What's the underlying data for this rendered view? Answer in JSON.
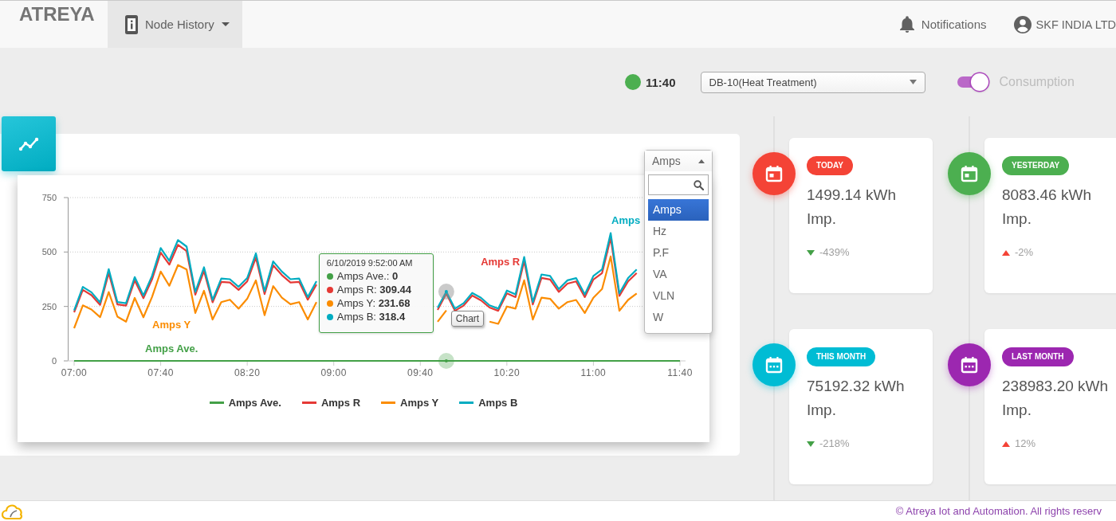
{
  "navbar": {
    "brand": "ATREYA",
    "menu": {
      "label": "Node History",
      "selected": true
    },
    "notifications": "Notifications",
    "account": "SKF INDIA LTD"
  },
  "toolbar": {
    "status": {
      "online": true,
      "time": "11:40"
    },
    "node_select": {
      "value": "DB-10(Heat Treatment)"
    },
    "toggle": {
      "on": true,
      "label": "Consumption"
    }
  },
  "chart_panel": {
    "unit_select": {
      "value": "Amps",
      "expanded": true,
      "options": [
        {
          "label": "Amps",
          "selected": true
        },
        {
          "label": "Hz",
          "selected": false
        },
        {
          "label": "P.F",
          "selected": false
        },
        {
          "label": "VA",
          "selected": false
        },
        {
          "label": "VLN",
          "selected": false
        },
        {
          "label": "W",
          "selected": false
        }
      ]
    },
    "chart_data": {
      "type": "line",
      "categories": [
        "07:00",
        null,
        null,
        null,
        null,
        null,
        null,
        null,
        null,
        null,
        "07:40",
        null,
        null,
        null,
        null,
        null,
        null,
        null,
        null,
        null,
        "08:20",
        null,
        null,
        null,
        null,
        null,
        null,
        null,
        null,
        null,
        "09:00",
        null,
        null,
        null,
        null,
        null,
        null,
        null,
        null,
        null,
        "09:40",
        null,
        null,
        null,
        null,
        null,
        null,
        null,
        null,
        null,
        "10:20",
        null,
        null,
        null,
        null,
        null,
        null,
        null,
        null,
        null,
        "11:00",
        null,
        null,
        null,
        null,
        null,
        null,
        null,
        null,
        null,
        "11:40"
      ],
      "ylim": [
        0,
        750
      ],
      "yticks": [
        0,
        250,
        500,
        750
      ],
      "series": [
        {
          "name": "Amps Ave.",
          "color": "#43a047",
          "values": [
            0,
            0,
            0,
            0,
            0,
            0,
            0,
            0,
            0,
            0,
            0,
            0,
            0,
            0,
            0,
            0,
            0,
            0,
            0,
            0,
            0,
            0,
            0,
            0,
            0,
            0,
            0,
            0,
            0,
            0,
            0,
            0,
            0,
            0,
            0,
            0,
            0,
            0,
            0,
            0,
            0,
            0,
            0,
            0,
            0,
            0,
            0,
            0,
            0,
            0,
            0,
            0,
            0,
            0,
            0,
            0,
            0,
            0,
            0,
            0,
            0,
            0,
            0,
            0,
            0,
            0,
            0,
            0,
            0,
            0,
            0
          ]
        },
        {
          "name": "Amps R",
          "color": "#e53935",
          "values": [
            223,
            326,
            302,
            257,
            404,
            259,
            254,
            370,
            288,
            374,
            497,
            442,
            533,
            504,
            304,
            413,
            269,
            363,
            360,
            326,
            365,
            474,
            307,
            439,
            394,
            360,
            363,
            281,
            351,
            null,
            null,
            null,
            null,
            null,
            null,
            null,
            null,
            null,
            null,
            null,
            null,
            null,
            234,
            309,
            230,
            254,
            300,
            278,
            245,
            230,
            310,
            293,
            458,
            259,
            381,
            374,
            317,
            355,
            365,
            293,
            374,
            403,
            564,
            298,
            365,
            403,
            null,
            null,
            null,
            null,
            null
          ]
        },
        {
          "name": "Amps Y",
          "color": "#fb8c00",
          "values": [
            150,
            255,
            236,
            201,
            316,
            203,
            180,
            289,
            200,
            293,
            410,
            345,
            440,
            420,
            220,
            322,
            190,
            270,
            281,
            240,
            285,
            370,
            210,
            343,
            290,
            260,
            270,
            190,
            270,
            null,
            null,
            null,
            null,
            null,
            null,
            null,
            null,
            null,
            null,
            null,
            null,
            null,
            180,
            232,
            null,
            null,
            null,
            null,
            180,
            170,
            250,
            240,
            370,
            190,
            290,
            285,
            240,
            270,
            280,
            220,
            290,
            330,
            480,
            230,
            280,
            310,
            null,
            null,
            null,
            null,
            null
          ]
        },
        {
          "name": "Amps B",
          "color": "#00acc1",
          "values": [
            232,
            340,
            315,
            268,
            421,
            270,
            265,
            385,
            300,
            390,
            518,
            460,
            555,
            525,
            317,
            430,
            280,
            378,
            375,
            340,
            380,
            494,
            320,
            457,
            410,
            375,
            378,
            293,
            366,
            null,
            null,
            null,
            null,
            null,
            null,
            null,
            null,
            null,
            null,
            null,
            null,
            null,
            244,
            318,
            240,
            265,
            312,
            290,
            255,
            240,
            323,
            305,
            477,
            270,
            397,
            390,
            330,
            370,
            380,
            305,
            390,
            420,
            587,
            310,
            380,
            420,
            null,
            null,
            null,
            null,
            null
          ]
        }
      ]
    },
    "series_labels": [
      {
        "text": "Amps Y",
        "color": "#fb8c00"
      },
      {
        "text": "Amps Ave.",
        "color": "#43a047"
      },
      {
        "text": "Amps R",
        "color": "#e53935"
      },
      {
        "text": "Amps",
        "color": "#00acc1"
      }
    ],
    "tooltip": {
      "title": "6/10/2019 9:52:00 AM",
      "rows": [
        {
          "text": "Amps Ave.: **0**",
          "color": "#43a047"
        },
        {
          "text": "Amps R: **309.44**",
          "color": "#e53935"
        },
        {
          "text": "Amps Y: **231.68**",
          "color": "#fb8c00"
        },
        {
          "text": "Amps B: **318.4**",
          "color": "#00acc1"
        }
      ]
    },
    "hover_hint": "Chart"
  },
  "stat_cards": [
    {
      "badge": "TODAY",
      "color": "#f44336",
      "kind": "day",
      "value": "1499.14 kWh",
      "label": "Imp.",
      "increase": false,
      "change": "-439%"
    },
    {
      "badge": "YESTERDAY",
      "color": "#4caf50",
      "kind": "day",
      "value": "8083.46 kWh",
      "label": "Imp.",
      "increase": true,
      "change": "-2%"
    },
    {
      "badge": "THIS MONTH",
      "color": "#00bcd4",
      "kind": "month",
      "value": "75192.32 kWh",
      "label": "Imp.",
      "increase": false,
      "change": "-218%"
    },
    {
      "badge": "LAST MONTH",
      "color": "#9c27b0",
      "kind": "month",
      "value": "238983.20 kWh",
      "label": "Imp.",
      "increase": true,
      "change": "12%"
    }
  ],
  "footer": {
    "copyright": "© Atreya Iot and Automation. All rights reserv"
  }
}
